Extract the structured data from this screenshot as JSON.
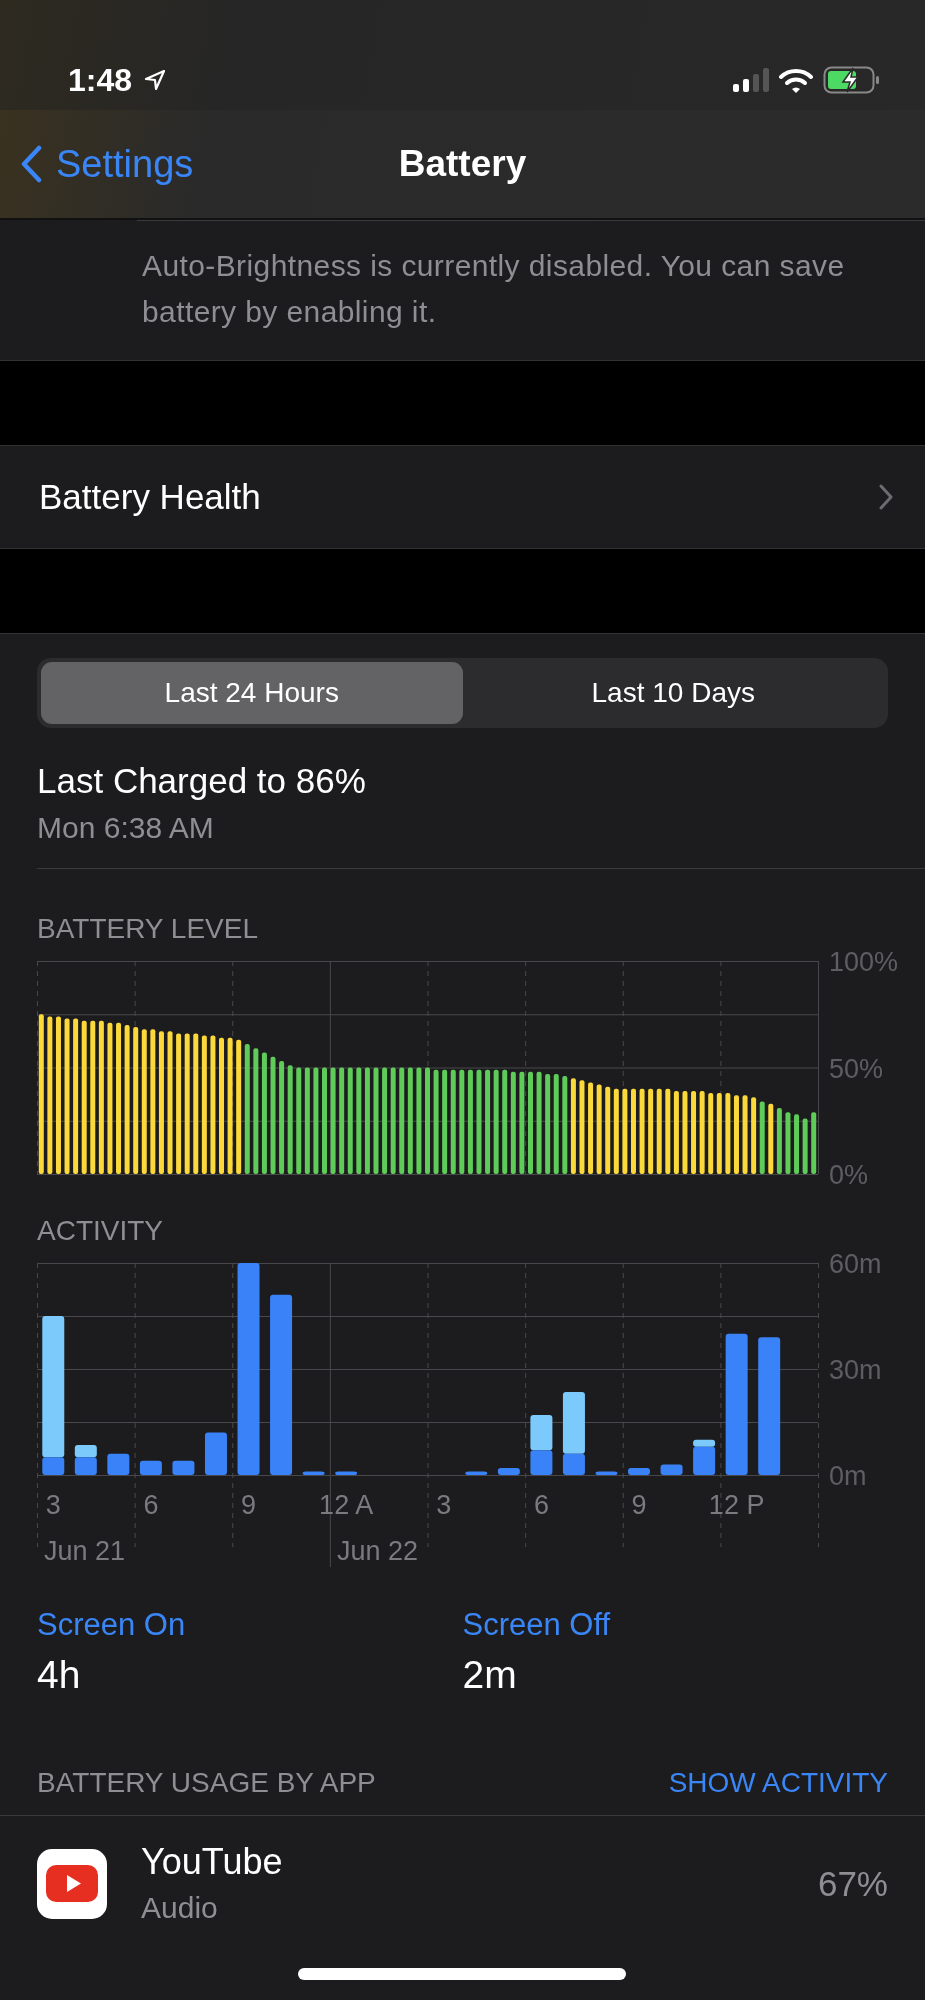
{
  "status_bar": {
    "time": "1:48"
  },
  "nav": {
    "back": "Settings",
    "title": "Battery"
  },
  "brightness_note": "Auto-Brightness is currently disabled. You can save battery by enabling it.",
  "battery_health": {
    "label": "Battery Health"
  },
  "range_tabs": [
    {
      "label": "Last 24 Hours",
      "selected": true
    },
    {
      "label": "Last 10 Days",
      "selected": false
    }
  ],
  "last_charged": {
    "title": "Last Charged to 86%",
    "time": "Mon 6:38 AM"
  },
  "battery_level": {
    "chart_data": {
      "type": "bar",
      "title": "BATTERY LEVEL",
      "ylim": [
        0,
        100
      ],
      "yticks": [
        {
          "value": 0,
          "label": "0%"
        },
        {
          "value": 50,
          "label": "50%"
        },
        {
          "value": 100,
          "label": "100%"
        }
      ],
      "grid": true,
      "series": [
        {
          "color": "#fcd93a",
          "values": [
            75,
            74,
            74,
            73,
            73,
            72,
            72,
            72,
            71,
            71,
            70,
            69,
            68,
            68,
            67,
            67,
            66,
            66,
            66,
            65,
            65,
            64,
            64,
            63,
            null,
            null,
            null,
            null,
            null,
            null,
            null,
            null,
            null,
            null,
            null,
            null,
            null,
            null,
            null,
            null,
            null,
            null,
            null,
            null,
            null,
            null,
            null,
            null,
            null,
            null,
            null,
            null,
            null,
            null,
            null,
            null,
            null,
            null,
            null,
            null,
            null,
            null,
            45,
            44,
            43,
            42,
            41,
            40,
            40,
            40,
            40,
            40,
            40,
            40,
            39,
            39,
            39,
            39,
            38,
            38,
            38,
            37,
            37,
            36,
            null,
            33,
            null,
            null,
            null,
            null,
            null
          ]
        },
        {
          "color": "#5fcc5a",
          "values": [
            null,
            null,
            null,
            null,
            null,
            null,
            null,
            null,
            null,
            null,
            null,
            null,
            null,
            null,
            null,
            null,
            null,
            null,
            null,
            null,
            null,
            null,
            null,
            null,
            61,
            59,
            57,
            55,
            53,
            51,
            50,
            50,
            50,
            50,
            50,
            50,
            50,
            50,
            50,
            50,
            50,
            50,
            50,
            50,
            50,
            50,
            49,
            49,
            49,
            49,
            49,
            49,
            49,
            49,
            49,
            48,
            48,
            48,
            48,
            47,
            47,
            46,
            null,
            null,
            null,
            null,
            null,
            null,
            null,
            null,
            null,
            null,
            null,
            null,
            null,
            null,
            null,
            null,
            null,
            null,
            null,
            null,
            null,
            null,
            34,
            null,
            31,
            29,
            28,
            26,
            29
          ]
        }
      ]
    }
  },
  "activity": {
    "chart_data": {
      "type": "bar",
      "title": "ACTIVITY",
      "ylim": [
        0,
        60
      ],
      "yticks": [
        {
          "value": 0,
          "label": "0m"
        },
        {
          "value": 30,
          "label": "30m"
        },
        {
          "value": 60,
          "label": "60m"
        }
      ],
      "stacked": true,
      "grid": true,
      "categories": [
        "3",
        null,
        null,
        "6",
        null,
        null,
        "9",
        null,
        null,
        "12 A",
        null,
        null,
        "3",
        null,
        null,
        "6",
        null,
        null,
        "9",
        null,
        null,
        "12 P",
        null
      ],
      "series": [
        {
          "color": "#3a82f7",
          "values": [
            5,
            5,
            6,
            4,
            4,
            12,
            60,
            51,
            1,
            1,
            0,
            0,
            0,
            1,
            2,
            7,
            6,
            1,
            2,
            3,
            8,
            40,
            39
          ]
        },
        {
          "color": "#7ccafc",
          "values": [
            40,
            3.5,
            0,
            0,
            0,
            0,
            0,
            0,
            0,
            0,
            0,
            0,
            0,
            0,
            0,
            10,
            17.5,
            0,
            0,
            0,
            2,
            0,
            0
          ]
        }
      ]
    },
    "dates": [
      {
        "label": "Jun 21"
      },
      {
        "label": "Jun 22"
      }
    ]
  },
  "screen_time": [
    {
      "label": "Screen On",
      "value": "4h"
    },
    {
      "label": "Screen Off",
      "value": "2m"
    }
  ],
  "usage": {
    "title": "BATTERY USAGE BY APP",
    "action": "SHOW ACTIVITY",
    "apps": [
      {
        "name": "YouTube",
        "detail": "Audio",
        "percent": "67%"
      }
    ]
  }
}
